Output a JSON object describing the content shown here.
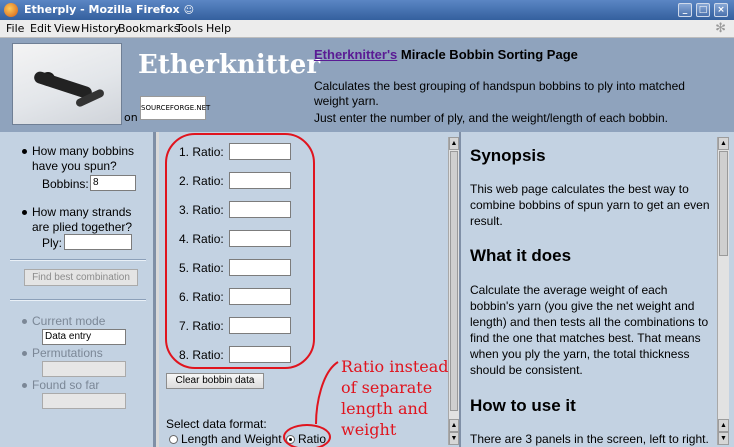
{
  "window": {
    "title": "Etherply - Mozilla Firefox",
    "workspace_glyph": "☺",
    "buttons": [
      "_",
      "□",
      "×"
    ]
  },
  "menu": [
    "File",
    "Edit",
    "View",
    "History",
    "Bookmarks",
    "Tools",
    "Help"
  ],
  "header": {
    "brand": "Etherknitter",
    "on_label": "on",
    "sourceforge_badge": "SOURCEFORGE.NET",
    "title_link": "Etherknitter's",
    "title_rest": " Miracle Bobbin Sorting Page",
    "description": "Calculates the best grouping of handspun bobbins to ply into matched weight yarn.",
    "instruction": "Just enter the number of ply, and the weight/length of each bobbin."
  },
  "left": {
    "q1_line1": "How many bobbins",
    "q1_line2": "have you spun?",
    "bobbins_label": "Bobbins:",
    "bobbins_value": "8",
    "q2_line1": "How many strands",
    "q2_line2": "are plied together?",
    "ply_label": "Ply:",
    "ply_value": "",
    "find_button": "Find best combination",
    "current_mode_label": "Current mode",
    "current_mode_value": "Data entry",
    "permutations_label": "Permutations",
    "found_label": "Found so far"
  },
  "middle": {
    "ratio_label": "Ratio:",
    "rows": [
      "1.",
      "2.",
      "3.",
      "4.",
      "5.",
      "6.",
      "7.",
      "8."
    ],
    "clear_button": "Clear bobbin data",
    "format_label": "Select data format:",
    "format_options": [
      "Length and Weight",
      "Ratio"
    ],
    "format_selected": "Ratio"
  },
  "right": {
    "h_synopsis": "Synopsis",
    "p_synopsis": "This web page calculates the best way to combine bobbins of spun yarn to get an even result.",
    "h_what": "What it does",
    "p_what": "Calculate the average weight of each bobbin's yarn (you give the net weight and length) and then tests all the combinations to find the one that matches best. That means when you ply the yarn, the total thickness should be consistent.",
    "h_how": "How to use it",
    "p_how": "There are 3 panels in the screen, left to right."
  },
  "annotation": {
    "line1": "Ratio instead",
    "line2": "of separate",
    "line3": "length and",
    "line4": "weight",
    "color": "#e0141e"
  }
}
